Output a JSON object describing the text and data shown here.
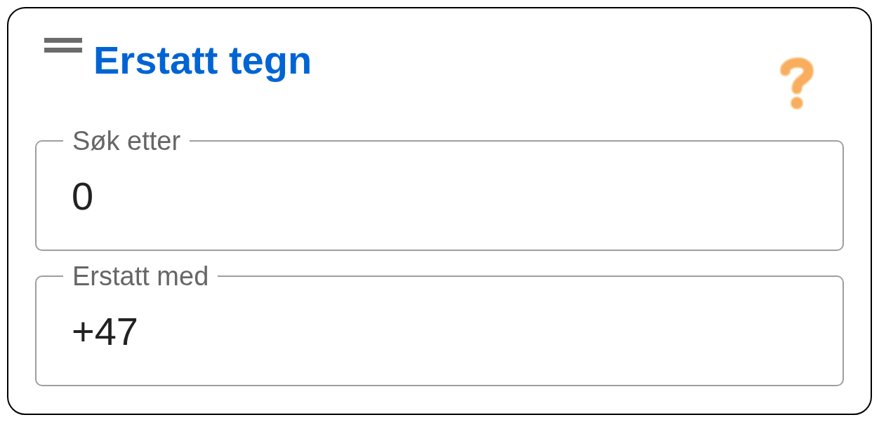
{
  "header": {
    "title": "Erstatt tegn"
  },
  "fields": [
    {
      "label": "Søk etter",
      "value": "0"
    },
    {
      "label": "Erstatt med",
      "value": "+47"
    }
  ]
}
